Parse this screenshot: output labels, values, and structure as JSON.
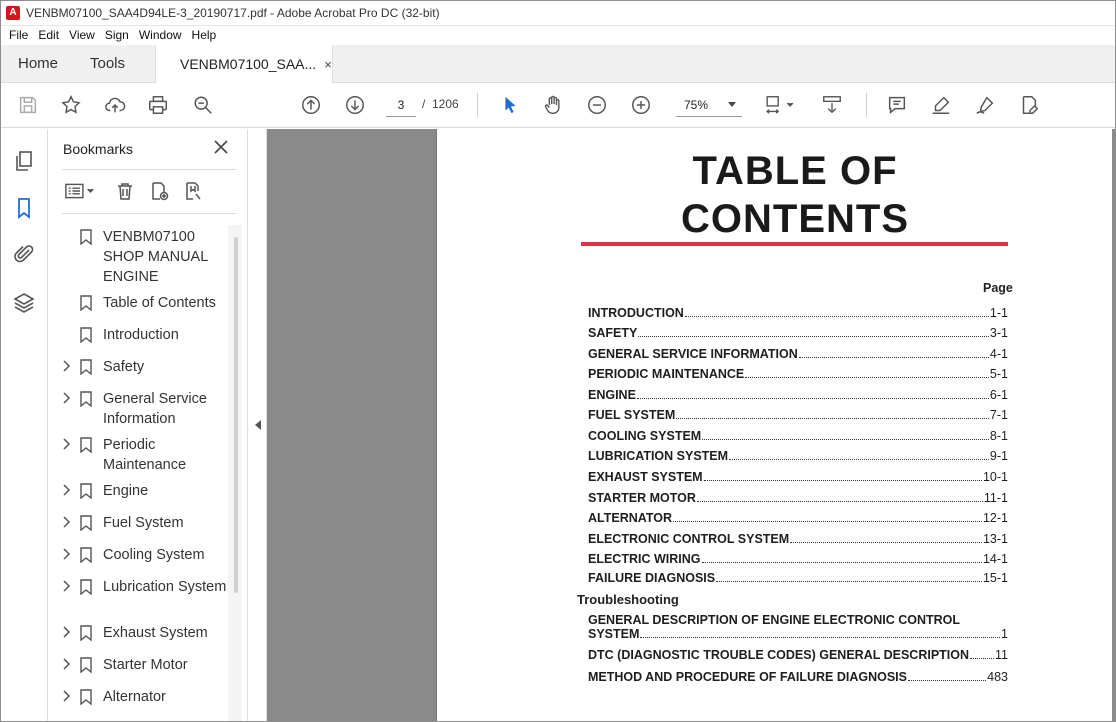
{
  "window": {
    "title": "VENBM07100_SAA4D94LE-3_20190717.pdf - Adobe Acrobat Pro DC (32-bit)"
  },
  "menu": [
    "File",
    "Edit",
    "View",
    "Sign",
    "Window",
    "Help"
  ],
  "tabs": {
    "home": "Home",
    "tools": "Tools",
    "doc": "VENBM07100_SAA...",
    "doc_close": "×"
  },
  "toolbar": {
    "page_current": "3",
    "page_sep": "/",
    "page_total": "1206",
    "zoom": "75%"
  },
  "bookmarks": {
    "title": "Bookmarks",
    "close": "✕",
    "items": [
      {
        "label": "VENBM07100 SHOP MANUAL ENGINE",
        "expandable": false
      },
      {
        "label": "Table of Contents",
        "expandable": false
      },
      {
        "label": "Introduction",
        "expandable": false
      },
      {
        "label": "Safety",
        "expandable": true
      },
      {
        "label": "General Service Information",
        "expandable": true
      },
      {
        "label": "Periodic Maintenance",
        "expandable": true
      },
      {
        "label": "Engine",
        "expandable": true
      },
      {
        "label": "Fuel System",
        "expandable": true
      },
      {
        "label": "Cooling System",
        "expandable": true
      },
      {
        "label": "Lubrication System",
        "expandable": true
      },
      {
        "label": "Exhaust System",
        "expandable": true
      },
      {
        "label": "Starter Motor",
        "expandable": true
      },
      {
        "label": "Alternator",
        "expandable": true
      }
    ]
  },
  "document": {
    "title_line1": "TABLE OF",
    "title_line2": "CONTENTS",
    "page_header": "Page",
    "accent_color": "#e0304a",
    "entries": [
      {
        "title": "INTRODUCTION",
        "page": "1-1"
      },
      {
        "title": "SAFETY",
        "page": "3-1"
      },
      {
        "title": "GENERAL SERVICE INFORMATION",
        "page": "4-1"
      },
      {
        "title": "PERIODIC MAINTENANCE",
        "page": "5-1"
      },
      {
        "title": "ENGINE",
        "page": "6-1"
      },
      {
        "title": "FUEL SYSTEM",
        "page": "7-1"
      },
      {
        "title": "COOLING SYSTEM",
        "page": "8-1"
      },
      {
        "title": "LUBRICATION SYSTEM",
        "page": "9-1"
      },
      {
        "title": "EXHAUST SYSTEM",
        "page": "10-1"
      },
      {
        "title": "STARTER MOTOR",
        "page": "11-1"
      },
      {
        "title": "ALTERNATOR",
        "page": "12-1"
      },
      {
        "title": "ELECTRONIC CONTROL SYSTEM",
        "page": "13-1"
      },
      {
        "title": "ELECTRIC WIRING",
        "page": "14-1"
      },
      {
        "title": "FAILURE DIAGNOSIS",
        "page": "15-1"
      }
    ],
    "section": "Troubleshooting",
    "ts_entry1_line1": "GENERAL DESCRIPTION OF ENGINE ELECTRONIC CONTROL",
    "ts_entry1_line2": "SYSTEM",
    "ts_entry1_page": "1",
    "ts_entry2_title": "DTC (DIAGNOSTIC TROUBLE CODES) GENERAL DESCRIPTION",
    "ts_entry2_page": "11",
    "ts_entry3_title": "METHOD AND PROCEDURE OF FAILURE DIAGNOSIS",
    "ts_entry3_page": "483"
  }
}
